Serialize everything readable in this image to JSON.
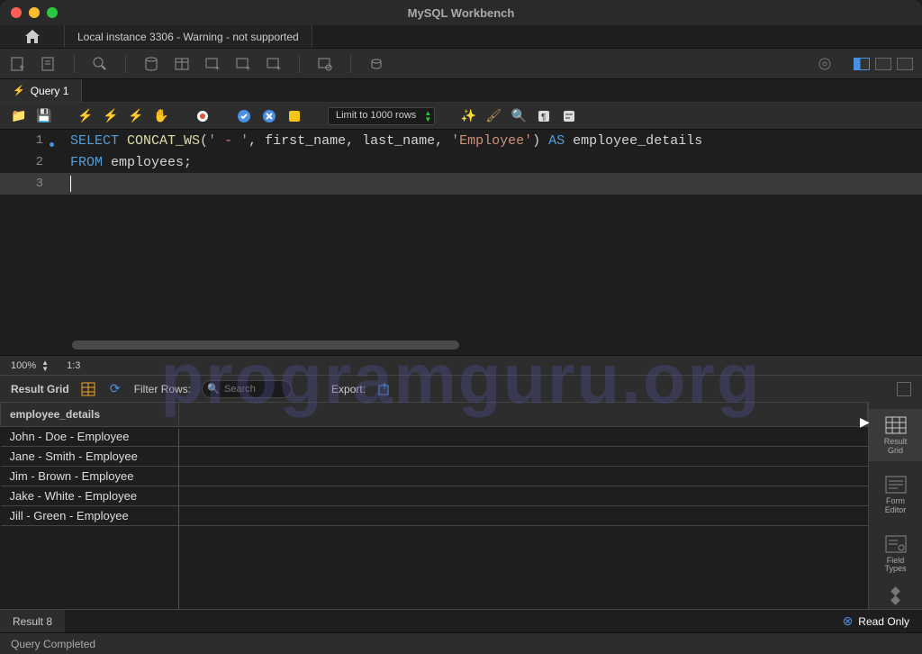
{
  "app_title": "MySQL Workbench",
  "connection_tab": "Local instance 3306 - Warning - not supported",
  "query_tab": "Query 1",
  "limit_select": "Limit to 1000 rows",
  "code": {
    "line1": {
      "num": "1",
      "select": "SELECT",
      "fn": "CONCAT_WS",
      "args_open": "(",
      "str1": "' - '",
      "c1": ", first_name, last_name, ",
      "str2": "'Employee'",
      "args_close": ")",
      "as": " AS",
      "alias": " employee_details"
    },
    "line2": {
      "num": "2",
      "from": "FROM",
      "table": " employees;"
    },
    "line3": {
      "num": "3"
    }
  },
  "zoom": "100%",
  "cursor_pos": "1:3",
  "result_toolbar": {
    "label": "Result Grid",
    "filter_label": "Filter Rows:",
    "filter_placeholder": "Search",
    "export_label": "Export:"
  },
  "result_header": "employee_details",
  "result_rows": [
    "John - Doe - Employee",
    "Jane - Smith - Employee",
    "Jim - Brown - Employee",
    "Jake - White - Employee",
    "Jill - Green - Employee"
  ],
  "side_panel": {
    "result_grid": "Result\nGrid",
    "form_editor": "Form\nEditor",
    "field_types": "Field\nTypes"
  },
  "result_tab_label": "Result 8",
  "readonly_label": "Read Only",
  "footer_status": "Query Completed",
  "watermark": "programguru.org"
}
